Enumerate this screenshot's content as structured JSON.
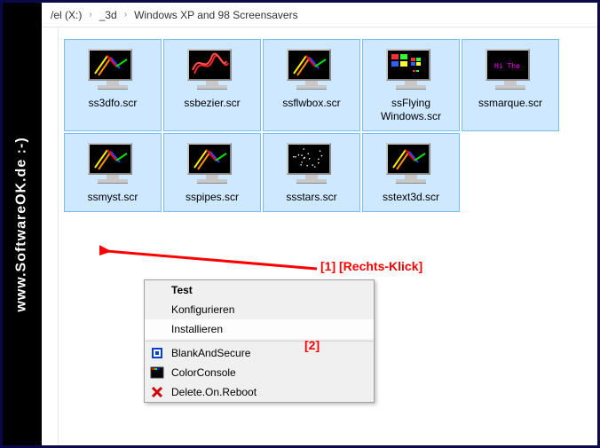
{
  "watermark": "www.SoftwareOK.de :-)",
  "breadcrumb": {
    "parts": [
      "/el (X:)",
      "_3d",
      "Windows XP and 98 Screensavers"
    ]
  },
  "files": [
    {
      "name": "ss3dfo.scr",
      "icon": "pipes"
    },
    {
      "name": "ssbezier.scr",
      "icon": "bezier"
    },
    {
      "name": "ssflwbox.scr",
      "icon": "pipes"
    },
    {
      "name": "ssFlying Windows.scr",
      "icon": "flywin"
    },
    {
      "name": "ssmarque.scr",
      "icon": "marquee"
    },
    {
      "name": "ssmyst.scr",
      "icon": "pipes"
    },
    {
      "name": "sspipes.scr",
      "icon": "pipes"
    },
    {
      "name": "ssstars.scr",
      "icon": "stars"
    },
    {
      "name": "sstext3d.scr",
      "icon": "pipes"
    }
  ],
  "context_menu": {
    "test": "Test",
    "configure": "Konfigurieren",
    "install": "Installieren",
    "blank_secure": "BlankAndSecure",
    "color_console": "ColorConsole",
    "delete_reboot": "Delete.On.Reboot"
  },
  "annotations": {
    "a1": "[1]",
    "a1_label": "[Rechts-Klick]",
    "a2": "[2]"
  }
}
